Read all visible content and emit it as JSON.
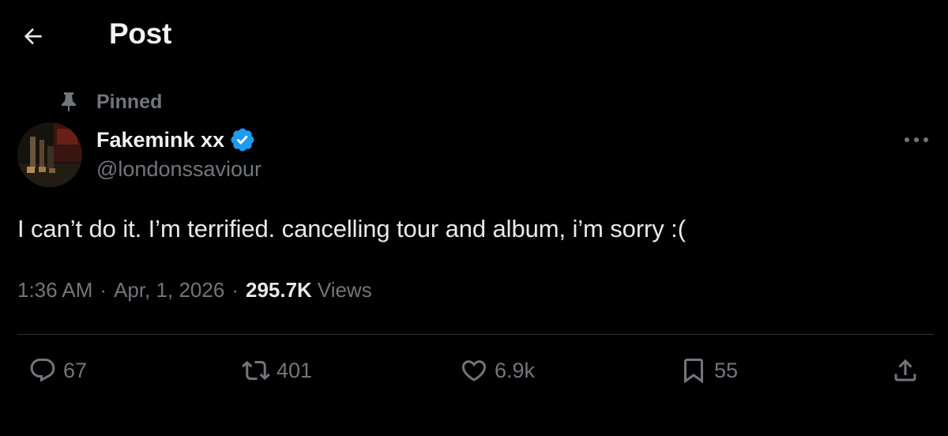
{
  "header": {
    "title": "Post"
  },
  "post": {
    "pinned_label": "Pinned",
    "author": {
      "display_name": "Fakemink xx",
      "handle": "@londonssaviour",
      "verified": true
    },
    "text": "I can’t do it. I’m terrified. cancelling tour and album, i’m sorry :(",
    "time": "1:36 AM",
    "separator": "·",
    "date": "Apr, 1, 2026",
    "views_count": "295.7K",
    "views_label": "Views"
  },
  "actions": {
    "replies": "67",
    "reposts": "401",
    "likes": "6.9k",
    "bookmarks": "55"
  },
  "colors": {
    "background": "#000000",
    "text_primary": "#e7e9ea",
    "text_secondary": "#71767b",
    "verified": "#1d9bf0",
    "divider": "#2f3336"
  },
  "icons": {
    "back": "arrow-left-icon",
    "pin": "pin-icon",
    "verified": "verified-badge-icon",
    "more": "more-horizontal-icon",
    "reply": "reply-icon",
    "repost": "repost-icon",
    "like": "heart-icon",
    "bookmark": "bookmark-icon",
    "share": "share-icon"
  }
}
